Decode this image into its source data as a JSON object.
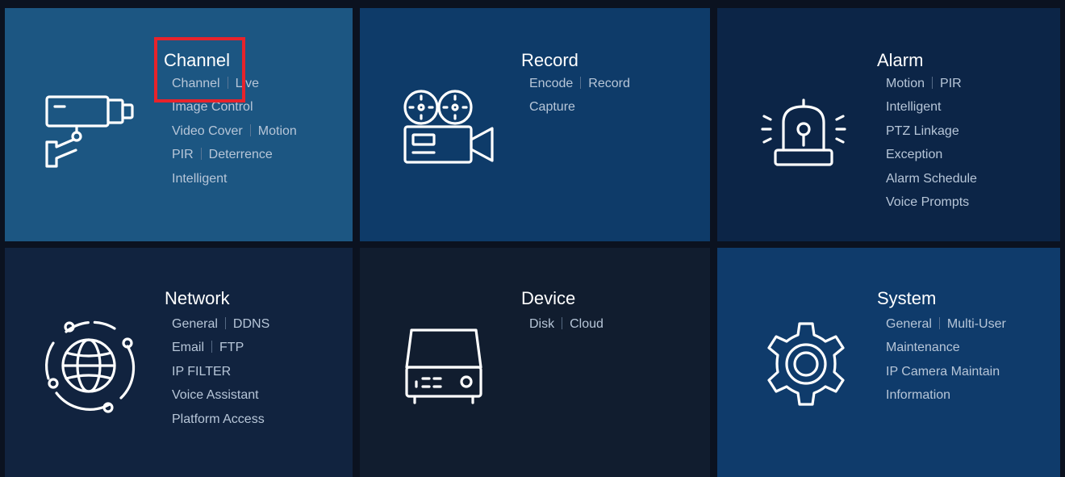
{
  "tiles": {
    "channel": {
      "title": "Channel",
      "color": "#1c5682",
      "rows": [
        [
          "Channel",
          "Live"
        ],
        [
          "Image Control"
        ],
        [
          "Video Cover",
          "Motion"
        ],
        [
          "PIR",
          "Deterrence"
        ],
        [
          "Intelligent"
        ]
      ]
    },
    "record": {
      "title": "Record",
      "color": "#0e3b69",
      "rows": [
        [
          "Encode",
          "Record"
        ],
        [
          "Capture"
        ]
      ]
    },
    "alarm": {
      "title": "Alarm",
      "color": "#0c2547",
      "rows": [
        [
          "Motion",
          "PIR"
        ],
        [
          "Intelligent"
        ],
        [
          "PTZ Linkage"
        ],
        [
          "Exception"
        ],
        [
          "Alarm Schedule"
        ],
        [
          "Voice Prompts"
        ]
      ]
    },
    "network": {
      "title": "Network",
      "color": "#11233f",
      "rows": [
        [
          "General",
          "DDNS"
        ],
        [
          "Email",
          "FTP"
        ],
        [
          "IP FILTER"
        ],
        [
          "Voice Assistant"
        ],
        [
          "Platform Access"
        ]
      ]
    },
    "device": {
      "title": "Device",
      "color": "#111d2f",
      "rows": [
        [
          "Disk",
          "Cloud"
        ]
      ]
    },
    "system": {
      "title": "System",
      "color": "#0f3b6b",
      "rows": [
        [
          "General",
          "Multi-User"
        ],
        [
          "Maintenance"
        ],
        [
          "IP Camera Maintain"
        ],
        [
          "Information"
        ]
      ]
    }
  },
  "icons": {
    "channel": "camera-icon",
    "record": "video-camera-icon",
    "alarm": "alarm-siren-icon",
    "network": "globe-network-icon",
    "device": "nvr-device-icon",
    "system": "gear-icon"
  },
  "highlight_color": "#e8232b"
}
